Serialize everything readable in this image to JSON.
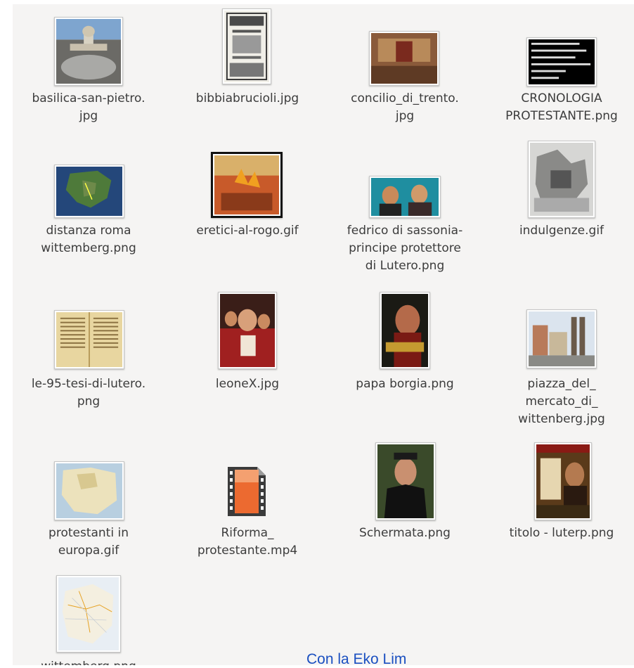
{
  "files": [
    {
      "id": "f1",
      "line1": "basilica-san-pietro.",
      "line2": "jpg",
      "line3": "",
      "icon": "photo-thumbnail"
    },
    {
      "id": "f2",
      "line1": "bibbiabrucioli.jpg",
      "line2": "",
      "line3": "",
      "icon": "photo-thumbnail"
    },
    {
      "id": "f3",
      "line1": "concilio_di_trento.",
      "line2": "jpg",
      "line3": "",
      "icon": "photo-thumbnail"
    },
    {
      "id": "f4",
      "line1": "CRONOLOGIA",
      "line2": "PROTESTANTE.png",
      "line3": "",
      "icon": "photo-thumbnail"
    },
    {
      "id": "f5",
      "line1": "distanza roma",
      "line2": "wittemberg.png",
      "line3": "",
      "icon": "photo-thumbnail"
    },
    {
      "id": "f6",
      "line1": "eretici-al-rogo.gif",
      "line2": "",
      "line3": "",
      "icon": "photo-thumbnail"
    },
    {
      "id": "f7",
      "line1": "fedrico di sassonia-",
      "line2": "principe protettore",
      "line3": "di Lutero.png",
      "icon": "photo-thumbnail"
    },
    {
      "id": "f8",
      "line1": "indulgenze.gif",
      "line2": "",
      "line3": "",
      "icon": "photo-thumbnail"
    },
    {
      "id": "f9",
      "line1": "le-95-tesi-di-lutero.",
      "line2": "png",
      "line3": "",
      "icon": "photo-thumbnail"
    },
    {
      "id": "f10",
      "line1": "leoneX.jpg",
      "line2": "",
      "line3": "",
      "icon": "photo-thumbnail"
    },
    {
      "id": "f11",
      "line1": "papa borgia.png",
      "line2": "",
      "line3": "",
      "icon": "photo-thumbnail"
    },
    {
      "id": "f12",
      "line1": "piazza_del_",
      "line2": "mercato_di_",
      "line3": "wittenberg.jpg",
      "icon": "photo-thumbnail"
    },
    {
      "id": "f13",
      "line1": "protestanti in",
      "line2": "europa.gif",
      "line3": "",
      "icon": "photo-thumbnail"
    },
    {
      "id": "f14",
      "line1": "Riforma_",
      "line2": "protestante.mp4",
      "line3": "",
      "icon": "video-file-icon"
    },
    {
      "id": "f15",
      "line1": "Schermata.png",
      "line2": "",
      "line3": "",
      "icon": "photo-thumbnail"
    },
    {
      "id": "f16",
      "line1": "titolo - luterp.png",
      "line2": "",
      "line3": "",
      "icon": "photo-thumbnail"
    },
    {
      "id": "f17",
      "line1": "wittemberg.png",
      "line2": "",
      "line3": "",
      "icon": "photo-thumbnail"
    }
  ],
  "footer": {
    "link_text": "Con la Eko Lim"
  },
  "colors": {
    "background": "#f5f4f3",
    "label_text": "#3c3c3c",
    "link": "#1a4fc0",
    "video_orange": "#e8632a"
  }
}
